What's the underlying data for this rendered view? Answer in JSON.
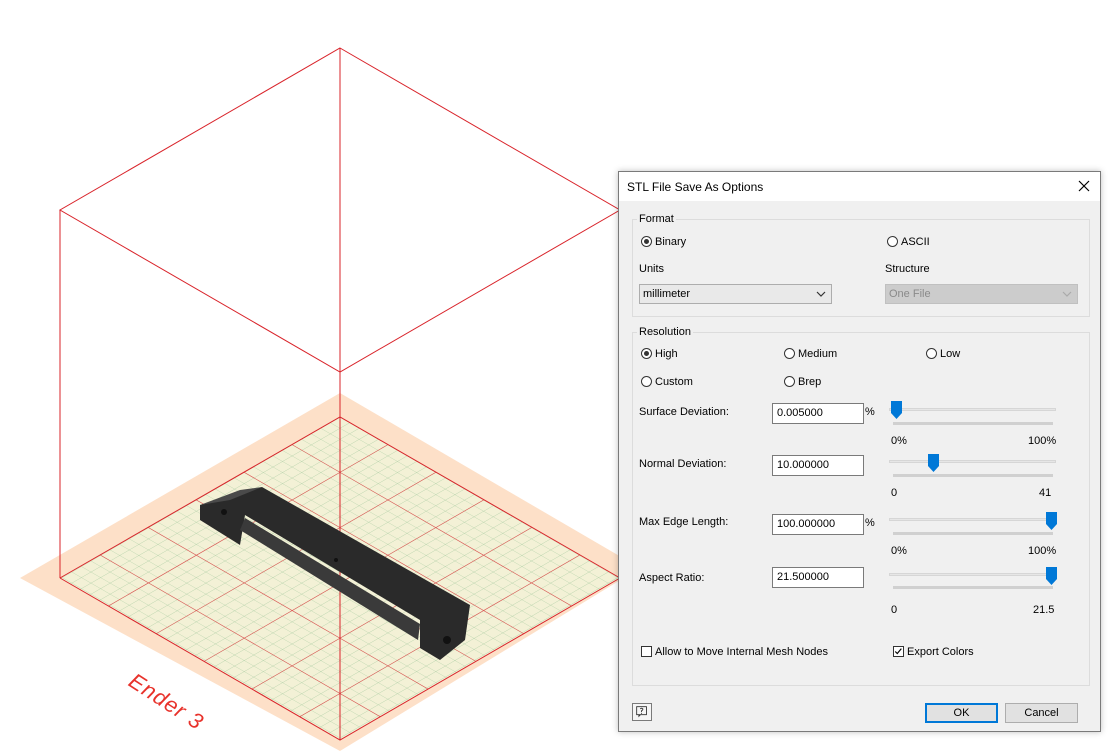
{
  "viewport": {
    "bed_label": "Ender 3"
  },
  "dialog": {
    "title": "STL File Save As Options",
    "format": {
      "legend": "Format",
      "binary_label": "Binary",
      "ascii_label": "ASCII",
      "selected": "Binary",
      "units_label": "Units",
      "units_value": "millimeter",
      "structure_label": "Structure",
      "structure_value": "One File"
    },
    "resolution": {
      "legend": "Resolution",
      "high_label": "High",
      "medium_label": "Medium",
      "low_label": "Low",
      "custom_label": "Custom",
      "brep_label": "Brep",
      "selected": "High",
      "surface_deviation": {
        "label": "Surface Deviation:",
        "value": "0.005000",
        "unit": "%",
        "min_label": "0%",
        "max_label": "100%",
        "slider_pos": 0.02
      },
      "normal_deviation": {
        "label": "Normal Deviation:",
        "value": "10.000000",
        "min_label": "0",
        "max_label": "41",
        "slider_pos": 0.25
      },
      "max_edge_length": {
        "label": "Max Edge Length:",
        "value": "100.000000",
        "unit": "%",
        "min_label": "0%",
        "max_label": "100%",
        "slider_pos": 1.0
      },
      "aspect_ratio": {
        "label": "Aspect Ratio:",
        "value": "21.500000",
        "min_label": "0",
        "max_label": "21.5",
        "slider_pos": 1.0
      },
      "allow_move_label": "Allow to Move Internal Mesh Nodes",
      "allow_move_checked": false,
      "export_colors_label": "Export Colors",
      "export_colors_checked": true
    },
    "buttons": {
      "ok": "OK",
      "cancel": "Cancel"
    },
    "accent_color": "#0078d7"
  }
}
